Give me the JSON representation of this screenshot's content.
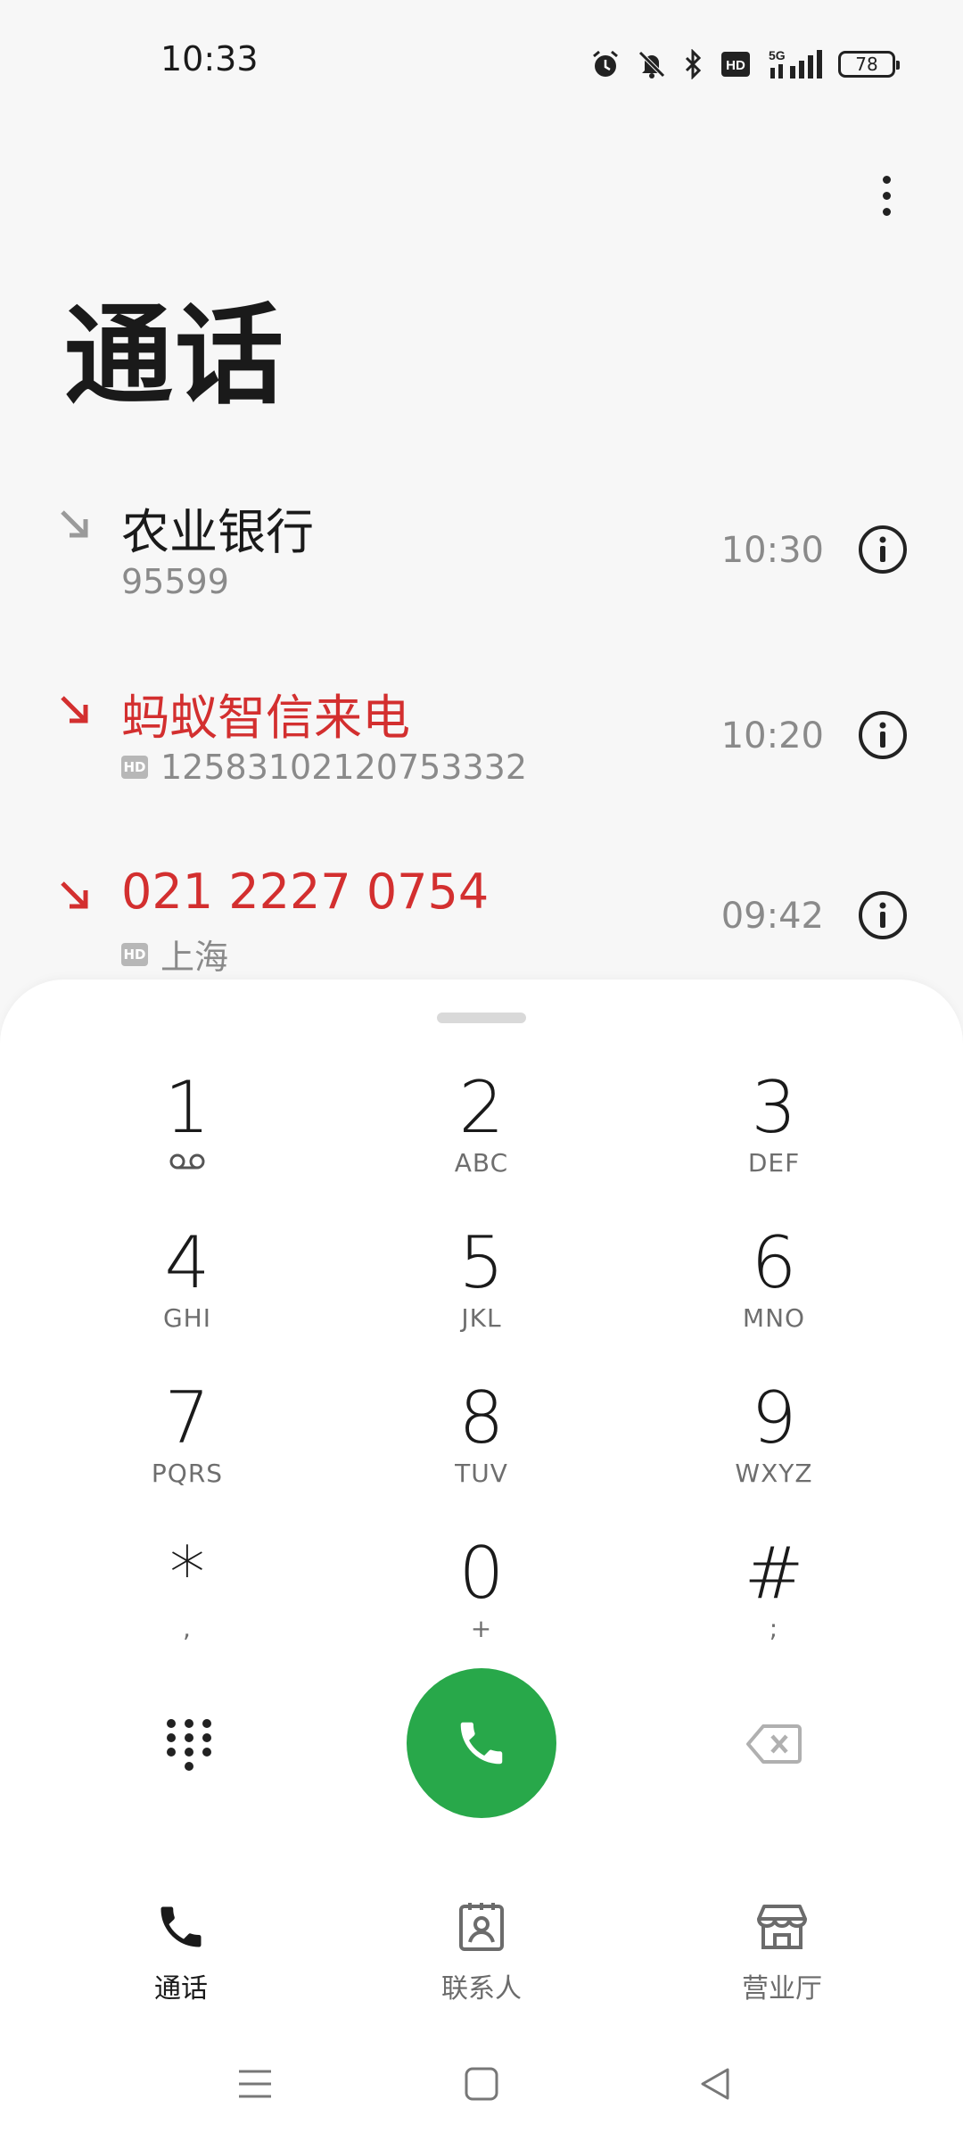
{
  "status_bar": {
    "time": "10:33",
    "signal_label": "5G",
    "battery": "78",
    "icons": [
      "alarm-icon",
      "mute-icon",
      "bluetooth-icon",
      "hd-icon",
      "signal-icon",
      "battery-icon"
    ]
  },
  "header": {
    "title": "通话",
    "menu_icon": "more-vertical-icon"
  },
  "calls": [
    {
      "name": "农业银行",
      "number": "95599",
      "time": "10:30",
      "missed": false,
      "hd": false
    },
    {
      "name": "蚂蚁智信来电",
      "number": "12583102120753332",
      "time": "10:20",
      "missed": true,
      "hd": true
    },
    {
      "name": "021 2227 0754",
      "number": "上海",
      "time": "09:42",
      "missed": true,
      "hd": true
    }
  ],
  "dialpad": {
    "keys": [
      {
        "digit": "1",
        "letters": ""
      },
      {
        "digit": "2",
        "letters": "ABC"
      },
      {
        "digit": "3",
        "letters": "DEF"
      },
      {
        "digit": "4",
        "letters": "GHI"
      },
      {
        "digit": "5",
        "letters": "JKL"
      },
      {
        "digit": "6",
        "letters": "MNO"
      },
      {
        "digit": "7",
        "letters": "PQRS"
      },
      {
        "digit": "8",
        "letters": "TUV"
      },
      {
        "digit": "9",
        "letters": "WXYZ"
      },
      {
        "digit": "*",
        "letters": ","
      },
      {
        "digit": "0",
        "letters": "+"
      },
      {
        "digit": "#",
        "letters": ";"
      }
    ],
    "hd_badge": "HD",
    "accent_color": "#28a84a",
    "missed_color": "#d32f2f"
  },
  "tabs": [
    {
      "label": "通话",
      "icon": "phone-icon",
      "active": true
    },
    {
      "label": "联系人",
      "icon": "contacts-icon",
      "active": false
    },
    {
      "label": "营业厅",
      "icon": "store-icon",
      "active": false
    }
  ],
  "nav": [
    "menu-icon",
    "home-icon",
    "back-icon"
  ]
}
